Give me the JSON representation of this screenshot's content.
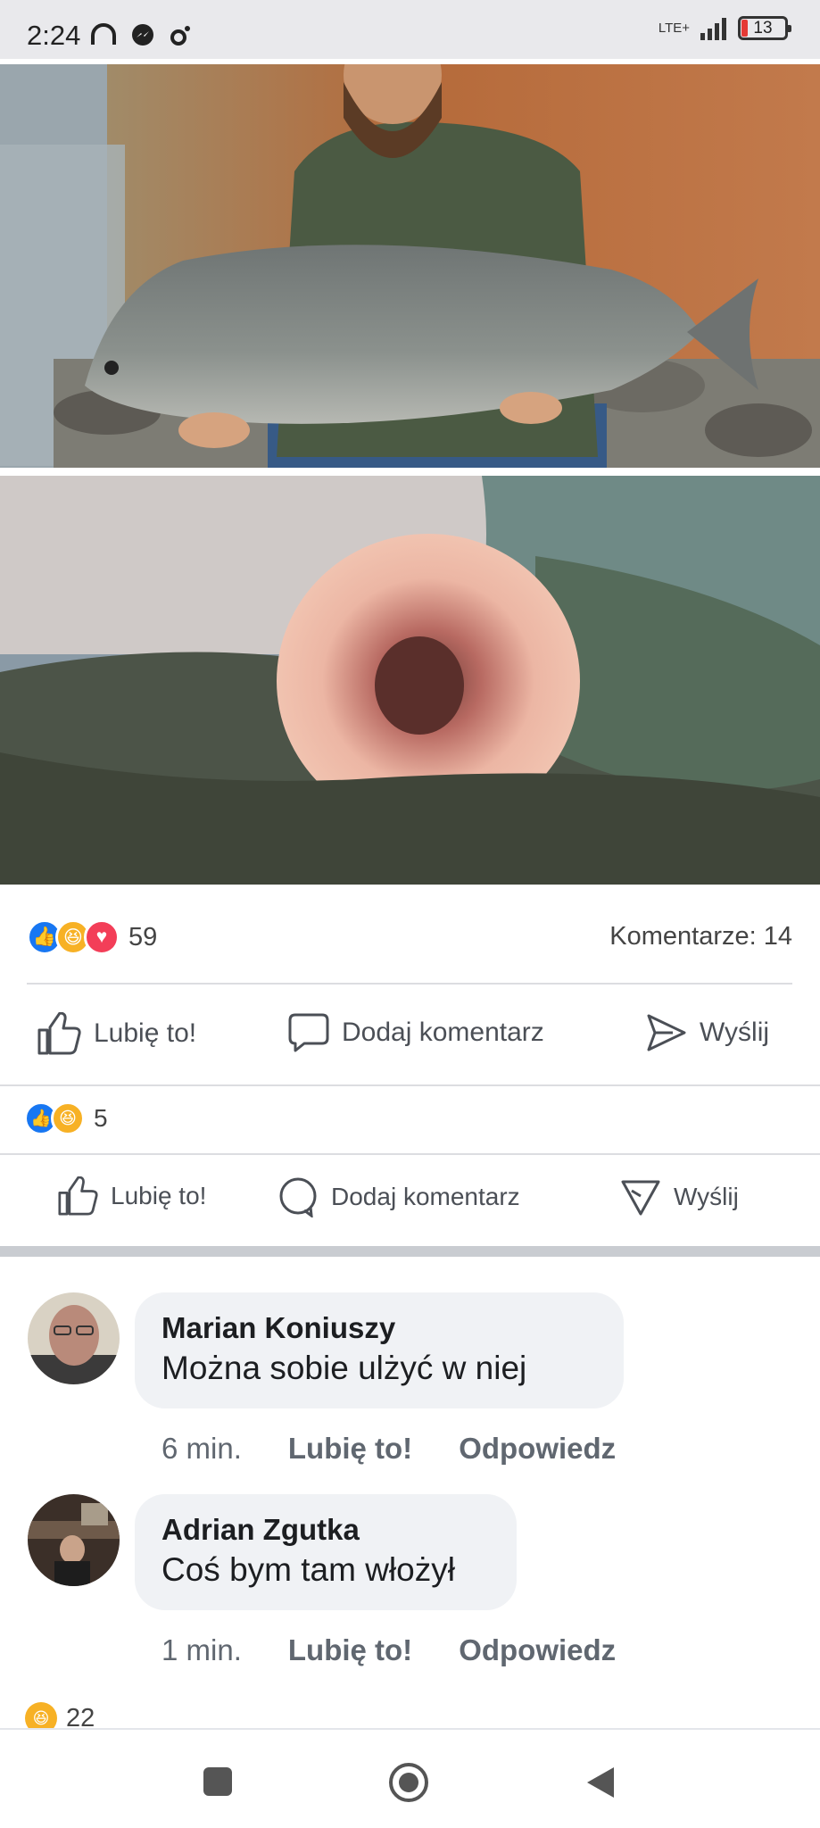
{
  "status_bar": {
    "time": "2:24",
    "network": "LTE+",
    "battery": "13"
  },
  "post": {
    "reactions_count": "59",
    "comments_count": "Komentarze: 14",
    "actions": {
      "like": "Lubię to!",
      "comment": "Dodaj komentarz",
      "send": "Wyślij"
    }
  },
  "inner_post": {
    "reactions_count": "5",
    "actions": {
      "like": "Lubię to!",
      "comment": "Dodaj komentarz",
      "send": "Wyślij"
    }
  },
  "comments": [
    {
      "author": "Marian Koniuszy",
      "text": "Można sobie ulżyć w niej",
      "time": "6 min.",
      "like": "Lubię to!",
      "reply": "Odpowiedz"
    },
    {
      "author": "Adrian Zgutka",
      "text": "Coś bym tam włożył",
      "time": "1 min.",
      "like": "Lubię to!",
      "reply": "Odpowiedz"
    }
  ],
  "bottom_reaction_count": "22",
  "colors": {
    "like_blue": "#1877f2",
    "haha_yellow": "#f7b125",
    "love_red": "#f33e58",
    "bubble_bg": "#f0f2f5"
  },
  "icons": [
    "headphones-icon",
    "messenger-icon",
    "settings-icon",
    "signal-icon",
    "like-icon",
    "comment-icon",
    "send-icon",
    "square-nav-icon",
    "home-nav-icon",
    "back-nav-icon"
  ]
}
